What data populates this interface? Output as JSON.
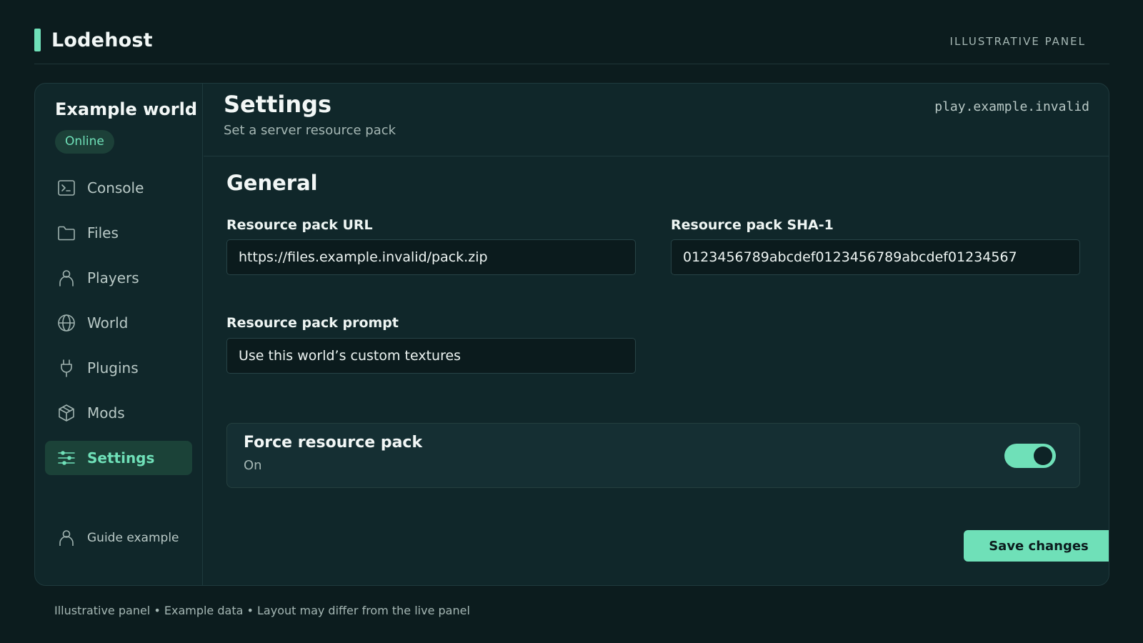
{
  "app": {
    "name": "Lodehost",
    "tag": "ILLUSTRATIVE PANEL"
  },
  "sidebar": {
    "world_name": "Example world",
    "status": "Online",
    "items": [
      {
        "label": "Console",
        "icon": "terminal-icon"
      },
      {
        "label": "Files",
        "icon": "folder-icon"
      },
      {
        "label": "Players",
        "icon": "person-icon"
      },
      {
        "label": "World",
        "icon": "globe-icon"
      },
      {
        "label": "Plugins",
        "icon": "plug-icon"
      },
      {
        "label": "Mods",
        "icon": "cube-icon"
      },
      {
        "label": "Settings",
        "icon": "sliders-icon",
        "active": true
      }
    ],
    "user": "Guide example"
  },
  "header": {
    "title": "Settings",
    "subtitle": "Set a server resource pack",
    "host": "play.example.invalid"
  },
  "section": {
    "title": "General"
  },
  "fields": {
    "url": {
      "label": "Resource pack URL",
      "value": "https://files.example.invalid/pack.zip"
    },
    "sha1": {
      "label": "Resource pack SHA-1",
      "value": "0123456789abcdef0123456789abcdef01234567"
    },
    "prompt": {
      "label": "Resource pack prompt",
      "value": "Use this world’s custom textures"
    }
  },
  "force": {
    "title": "Force resource pack",
    "state": "On",
    "enabled": true
  },
  "save_label": "Save changes",
  "footnote": "Illustrative panel • Example data • Layout may differ from the live panel",
  "colors": {
    "accent": "#6fe0b8",
    "background": "#0c1c1e",
    "panel": "#10272a"
  }
}
